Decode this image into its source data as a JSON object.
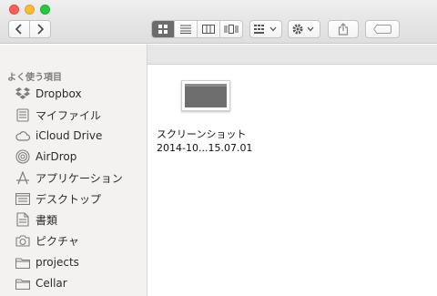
{
  "sidebar": {
    "section_label": "よく使う項目",
    "items": [
      {
        "label": "Dropbox",
        "icon": "dropbox-icon"
      },
      {
        "label": "マイファイル",
        "icon": "all-my-files-icon"
      },
      {
        "label": "iCloud Drive",
        "icon": "cloud-icon"
      },
      {
        "label": "AirDrop",
        "icon": "airdrop-icon"
      },
      {
        "label": "アプリケーション",
        "icon": "applications-icon"
      },
      {
        "label": "デスクトップ",
        "icon": "desktop-icon"
      },
      {
        "label": "書類",
        "icon": "documents-icon"
      },
      {
        "label": "ピクチャ",
        "icon": "camera-icon"
      },
      {
        "label": "projects",
        "icon": "folder-icon"
      },
      {
        "label": "Cellar",
        "icon": "folder-icon"
      }
    ]
  },
  "files": [
    {
      "name_line1": "スクリーンショット",
      "name_line2": "2014-10...15.07.01"
    }
  ],
  "colors": {
    "close": "#fc5f57",
    "minimize": "#fdbc2e",
    "maximize": "#28c840",
    "active_view": "#6c6c6c"
  }
}
